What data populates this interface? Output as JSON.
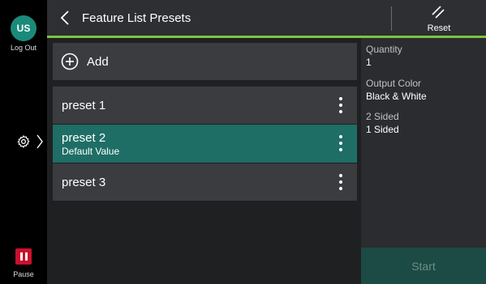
{
  "user": {
    "initials": "US",
    "logout_label": "Log Out"
  },
  "rail": {
    "pause_label": "Pause"
  },
  "header": {
    "title": "Feature List Presets",
    "reset_label": "Reset"
  },
  "list": {
    "add_label": "Add",
    "presets": [
      {
        "name": "preset 1",
        "sub": "",
        "selected": false
      },
      {
        "name": "preset 2",
        "sub": "Default Value",
        "selected": true
      },
      {
        "name": "preset 3",
        "sub": "",
        "selected": false
      }
    ]
  },
  "details": [
    {
      "label": "Quantity",
      "value": "1"
    },
    {
      "label": "Output Color",
      "value": "Black & White"
    },
    {
      "label": "2 Sided",
      "value": "1 Sided"
    }
  ],
  "start_label": "Start",
  "colors": {
    "accent_line": "#7fc242",
    "selected_row": "#1e6e66",
    "avatar": "#1a8a7a",
    "pause": "#c8102e"
  }
}
